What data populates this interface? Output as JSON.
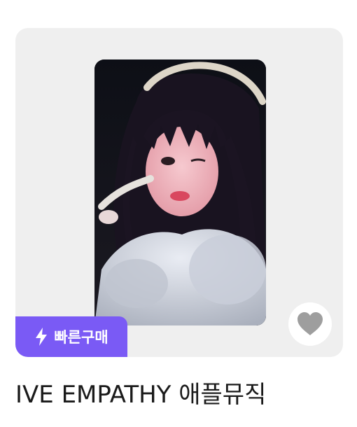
{
  "product": {
    "title": "IVE EMPATHY 애플뮤직",
    "image_alt": "photocard"
  },
  "badge": {
    "label": "빠른구매",
    "icon": "lightning-icon",
    "color": "#7a5af5"
  },
  "favorite": {
    "icon": "heart-icon",
    "color": "#9e9e9e"
  }
}
